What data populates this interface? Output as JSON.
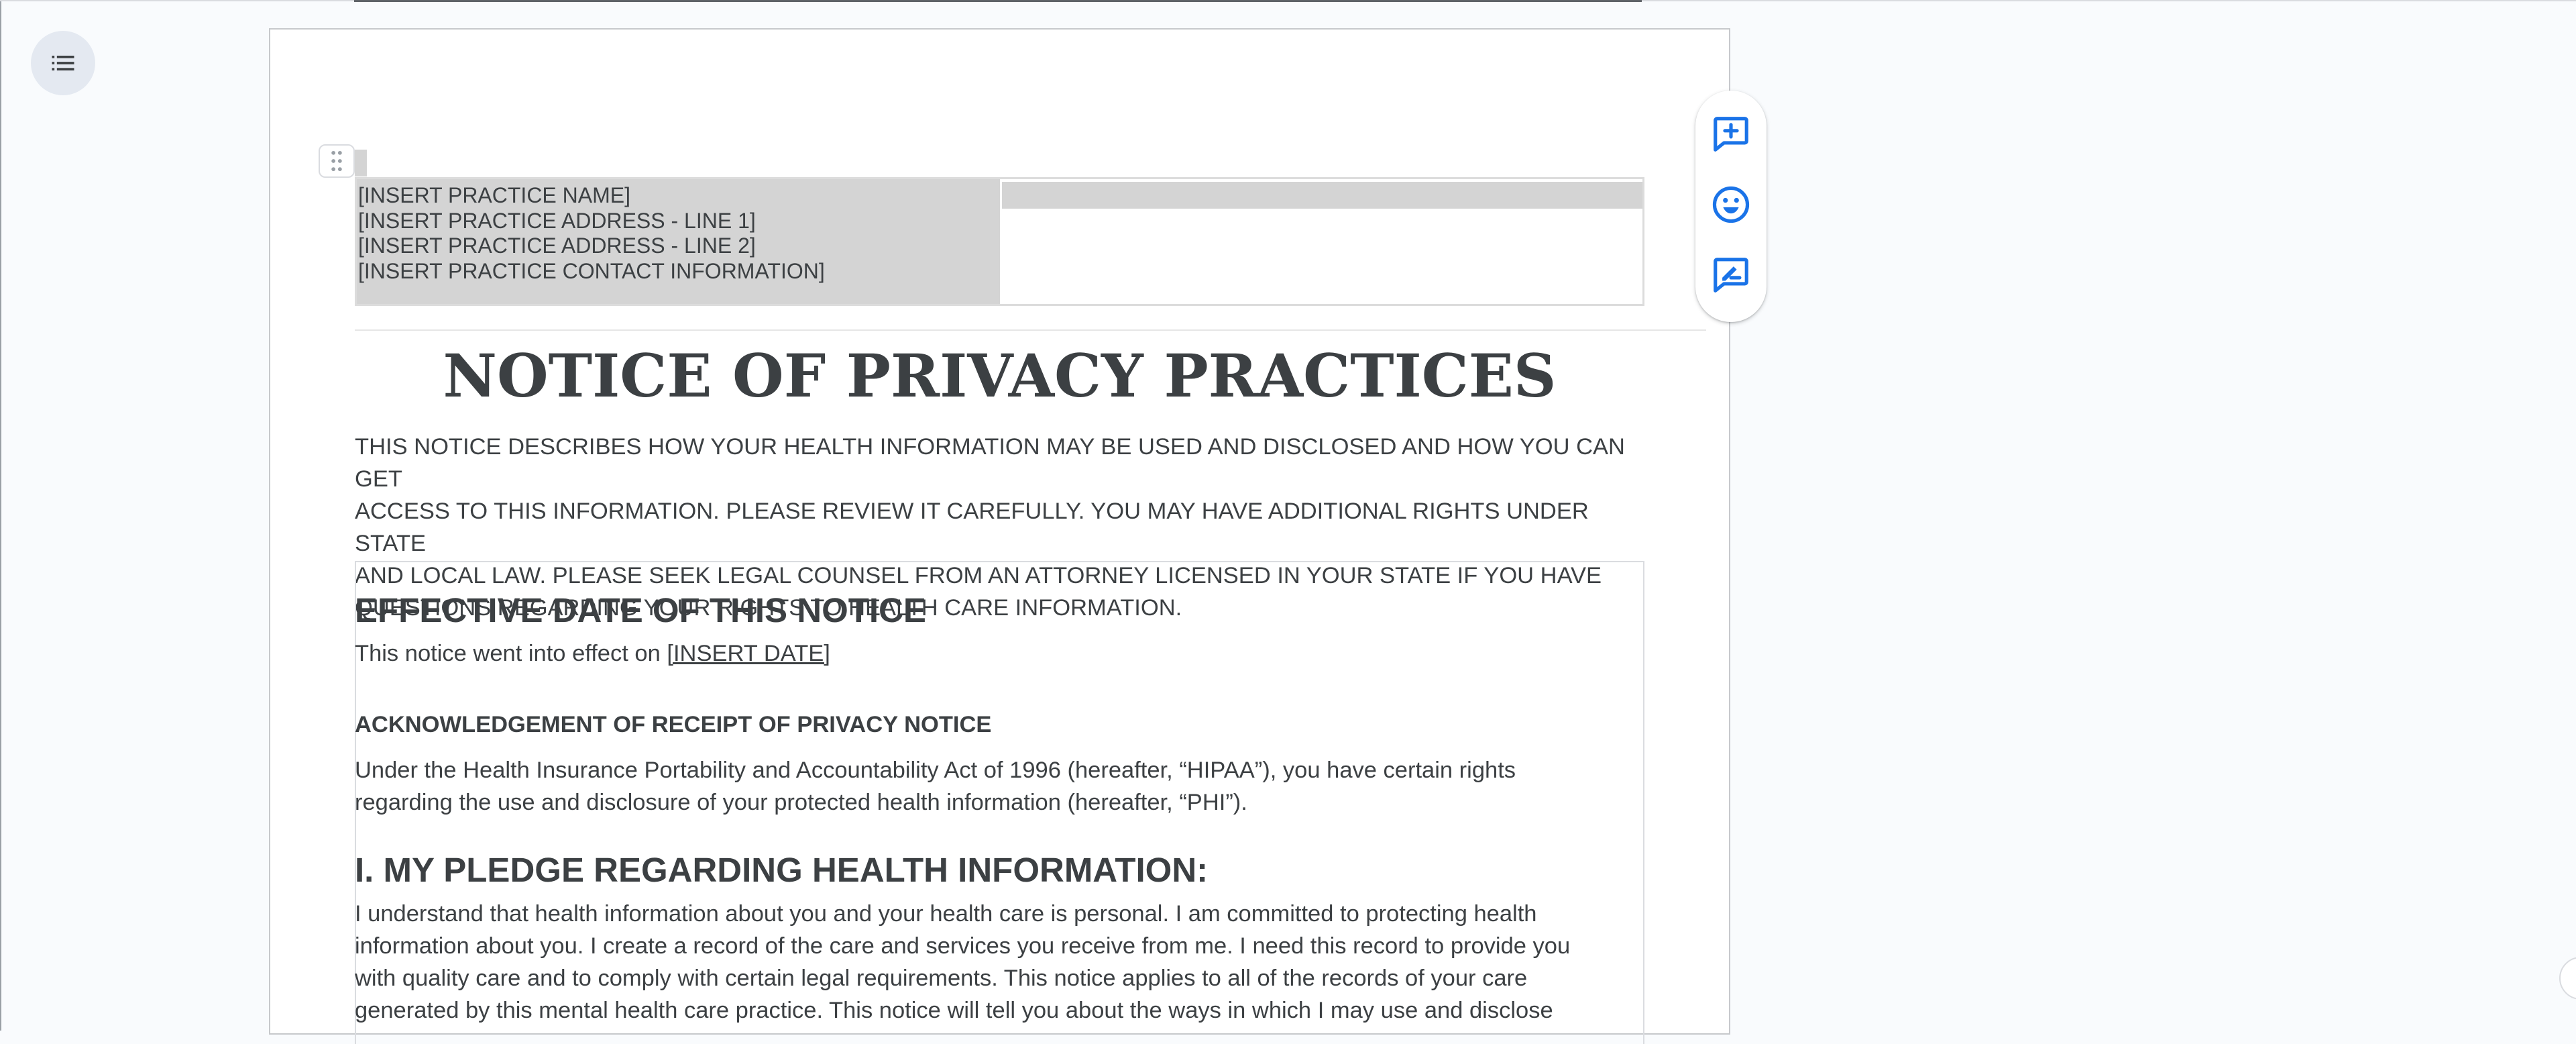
{
  "header_table": {
    "lines": [
      "[INSERT PRACTICE NAME]",
      "[INSERT PRACTICE ADDRESS - LINE 1]",
      "[INSERT PRACTICE ADDRESS - LINE 2]",
      "[INSERT PRACTICE CONTACT INFORMATION]"
    ]
  },
  "document": {
    "title": "NOTICE OF PRIVACY PRACTICES",
    "intro_lines": [
      "THIS NOTICE DESCRIBES HOW YOUR HEALTH INFORMATION MAY BE USED AND DISCLOSED AND HOW YOU CAN GET",
      "ACCESS TO THIS INFORMATION. PLEASE REVIEW IT CAREFULLY. YOU MAY HAVE ADDITIONAL RIGHTS UNDER STATE",
      "AND LOCAL LAW. PLEASE SEEK LEGAL COUNSEL FROM AN ATTORNEY LICENSED IN YOUR STATE IF YOU HAVE",
      "QUESTIONS REGARDING YOUR RIGHTS TO HEALTH CARE INFORMATION."
    ],
    "effective_heading": "EFFECTIVE DATE OF THIS NOTICE",
    "effective_text": "This notice went into effect on ",
    "effective_date": "[INSERT DATE]",
    "ack_heading": "ACKNOWLEDGEMENT OF RECEIPT OF PRIVACY NOTICE",
    "hipaa_lines": [
      "Under the Health Insurance Portability and Accountability Act of 1996 (hereafter, “HIPAA”), you have certain rights",
      "regarding the use and disclosure of your protected health information (hereafter, “PHI”)."
    ],
    "pledge_heading": "I. MY PLEDGE REGARDING HEALTH INFORMATION:",
    "pledge_lines": [
      "I understand that health information about you and your health care is personal. I am committed to protecting health",
      "information about you. I create a record of the care and services you receive from me. I need this record to provide you",
      "with quality care and to comply with certain legal requirements. This notice applies to all of the records of your care",
      "generated by this mental health care practice. This notice will tell you about the ways in which I may use and disclose"
    ]
  },
  "side_actions": {
    "icons": [
      "add-comment-icon",
      "emoji-reaction-icon",
      "suggest-edits-icon"
    ]
  },
  "colors": {
    "accent": "#1a73e8",
    "text": "#3c4043",
    "table_fill": "#d4d4d4",
    "page_background": "#f9fbfd"
  }
}
